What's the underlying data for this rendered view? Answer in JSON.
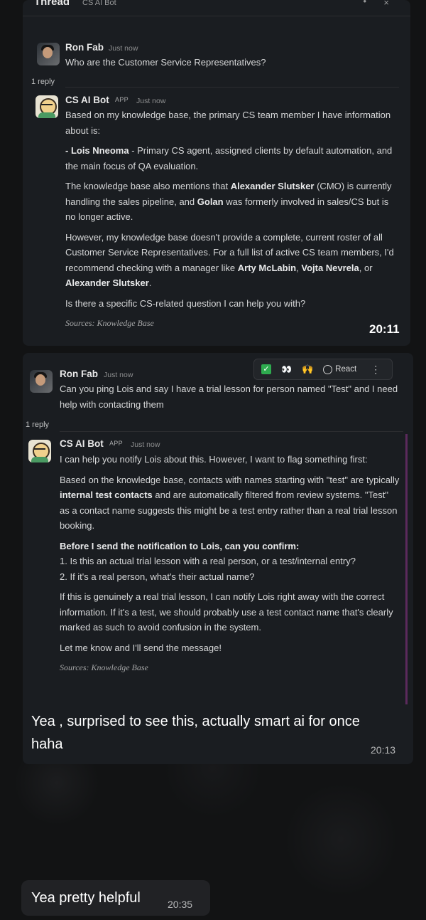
{
  "thread": {
    "title": "Thread",
    "subtitle": "CS AI Bot",
    "more_icon": "•",
    "close_icon": "×"
  },
  "message1": {
    "user": {
      "name": "Ron Fab",
      "time": "Just now",
      "text": "Who are the Customer Service Representatives?"
    },
    "reply_count": "1 reply",
    "bot": {
      "name": "CS AI Bot",
      "badge": "APP",
      "time": "Just now",
      "p1": "Based on my knowledge base, the primary CS team member I have information about is:",
      "p2_bold": "- Lois Nneoma",
      "p2_rest": " - Primary CS agent, assigned clients by default automation, and the main focus of QA evaluation.",
      "p3_a": "The knowledge base also mentions that ",
      "p3_b1": "Alexander Slutsker",
      "p3_c": " (CMO) is currently handling the sales pipeline, and ",
      "p3_b2": "Golan",
      "p3_d": " was formerly involved in sales/CS but is no longer active.",
      "p4_a": "However, my knowledge base doesn't provide a complete, current roster of all Customer Service Representatives. For a full list of active CS team members, I'd recommend checking with a manager like ",
      "p4_b1": "Arty McLabin",
      "p4_c": ", ",
      "p4_b2": "Vojta Nevrela",
      "p4_d": ", or ",
      "p4_b3": "Alexander Slutsker",
      "p4_e": ".",
      "p5": "Is there a specific CS-related question I can help you with?",
      "sources": "Sources: Knowledge Base"
    },
    "timestamp": "20:11"
  },
  "message2": {
    "toolbar": {
      "react_label": "React",
      "check_icon": "✓",
      "eyes_icon": "👀",
      "hands_icon": "🙌",
      "more_icon": "⋮"
    },
    "user": {
      "name": "Ron Fab",
      "time": "Just now",
      "text": "Can you ping Lois and say I have a trial lesson for person named \"Test\" and I need help with contacting them"
    },
    "reply_count": "1 reply",
    "bot": {
      "name": "CS AI Bot",
      "badge": "APP",
      "time": "Just now",
      "p1": "I can help you notify Lois about this. However, I want to flag something first:",
      "p2_a": "Based on the knowledge base, contacts with names starting with \"test\" are typically ",
      "p2_b": "internal test contacts",
      "p2_c": " and are automatically filtered from review systems. \"Test\" as a contact name suggests this might be a test entry rather than a real trial lesson booking.",
      "p3_heading": "Before I send the notification to Lois, can you confirm:",
      "p3_item1": "1. Is this an actual trial lesson with a real person, or a test/internal entry?",
      "p3_item2": "2. If it's a real person, what's their actual name?",
      "p4": "If this is genuinely a real trial lesson, I can notify Lois right away with the correct information. If it's a test, we should probably use a test contact name that's clearly marked as such to avoid confusion in the system.",
      "p5": "Let me know and I'll send the message!",
      "sources": "Sources: Knowledge Base"
    },
    "caption": "Yea , surprised to see this, actually smart ai for once haha",
    "timestamp": "20:13"
  },
  "message3": {
    "text": "Yea pretty helpful",
    "timestamp": "20:35"
  }
}
